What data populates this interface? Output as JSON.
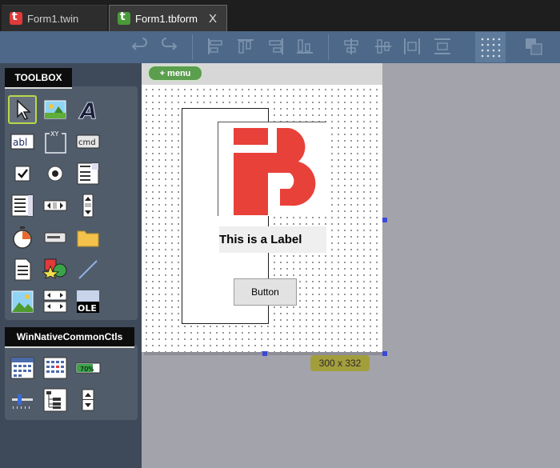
{
  "tabs": [
    {
      "label": "Form1.twin",
      "icon": "twinbasic-red-icon",
      "active": false
    },
    {
      "label": "Form1.tbform",
      "icon": "twinbasic-green-icon",
      "active": true,
      "close": "X"
    }
  ],
  "toolbar": {
    "icons": [
      "undo-icon",
      "redo-icon",
      "align-left-icon",
      "align-top-icon",
      "align-right-icon",
      "align-bottom-icon",
      "center-horizontal-icon",
      "center-vertical-icon",
      "space-horizontal-icon",
      "space-vertical-icon",
      "show-grid-icon",
      "bring-to-front-icon"
    ]
  },
  "toolbox": {
    "title": "TOOLBOX",
    "tools": [
      "pointer",
      "picturebox",
      "label",
      "textbox",
      "frame",
      "commandbutton",
      "checkbox",
      "optionbutton",
      "combobox",
      "listbox",
      "hscrollbar",
      "vscrollbar",
      "timer",
      "drivelistbox",
      "dirlistbox",
      "filelistbox",
      "shape",
      "line",
      "image",
      "data",
      "ole"
    ],
    "frame_caption": "XY",
    "command_caption": "cmd",
    "ole_caption": "OLE"
  },
  "common_ctls": {
    "title": "WinNativeCommonCtls",
    "tools": [
      "monthview",
      "dtpicker",
      "progressbar",
      "slider",
      "treeview",
      "updown"
    ],
    "progress_caption": "70%"
  },
  "designer": {
    "menu_label": "+ menu",
    "label_caption": "This is a Label",
    "button_caption": "Button",
    "size_badge": "300 x 332"
  },
  "colors": {
    "tabbar_bg": "#1e1e1e",
    "toolbar_bg": "#4d6888",
    "panel_bg": "#3e4a5a",
    "logo_red": "#e8413a",
    "selection_handle": "#3b49d6",
    "size_badge": "#a39e3c",
    "menu_pill": "#5a9e4e"
  }
}
